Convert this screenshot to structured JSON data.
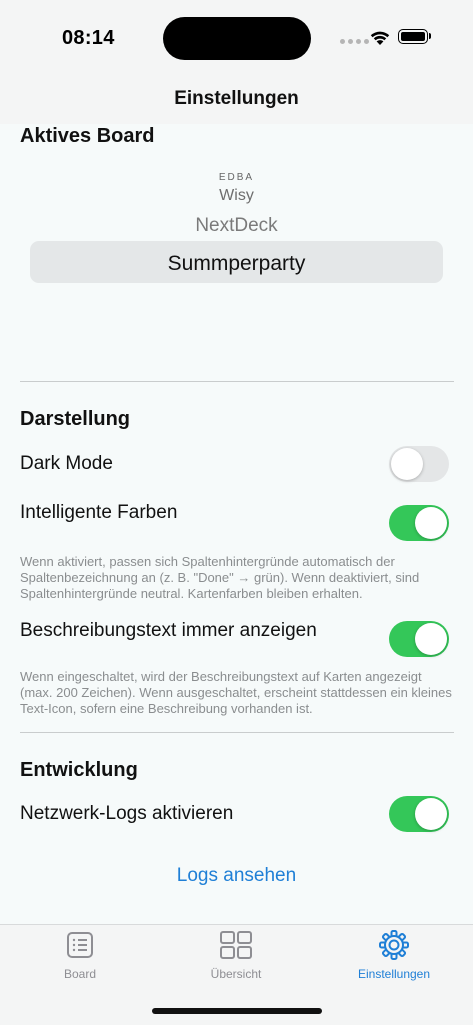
{
  "status_bar": {
    "time": "08:14"
  },
  "nav": {
    "title": "Einstellungen"
  },
  "active_board": {
    "title": "Aktives Board",
    "options": [
      "EDBA",
      "Wisy",
      "NextDeck",
      "Summperparty"
    ],
    "selected": "Summperparty"
  },
  "display": {
    "title": "Darstellung",
    "dark_mode": {
      "label": "Dark Mode",
      "on": false
    },
    "smart_colors": {
      "label": "Intelligente Farben",
      "on": true,
      "note": "Wenn aktiviert, passen sich Spaltenhintergründe automatisch der Spaltenbezeichnung an (z. B. \"Done\" → grün). Wenn deaktiviert, sind Spaltenhintergründe neutral. Kartenfarben bleiben erhalten."
    },
    "description_text": {
      "label": "Beschreibungstext immer anzeigen",
      "on": true,
      "note": "Wenn eingeschaltet, wird der Beschreibungstext auf Karten angezeigt (max. 200 Zeichen). Wenn ausgeschaltet, erscheint stattdessen ein kleines Text-Icon, sofern eine Beschreibung vorhanden ist."
    }
  },
  "development": {
    "title": "Entwicklung",
    "network_logs": {
      "label": "Netzwerk-Logs aktivieren",
      "on": true
    },
    "view_logs_label": "Logs ansehen"
  },
  "tabs": [
    {
      "label": "Board",
      "icon": "list-icon",
      "active": false
    },
    {
      "label": "Übersicht",
      "icon": "grid-icon",
      "active": false
    },
    {
      "label": "Einstellungen",
      "icon": "gear-icon",
      "active": true
    }
  ],
  "colors": {
    "accent": "#1f7fd6",
    "toggle_on": "#34c759",
    "toggle_off": "#e4e6e7"
  }
}
